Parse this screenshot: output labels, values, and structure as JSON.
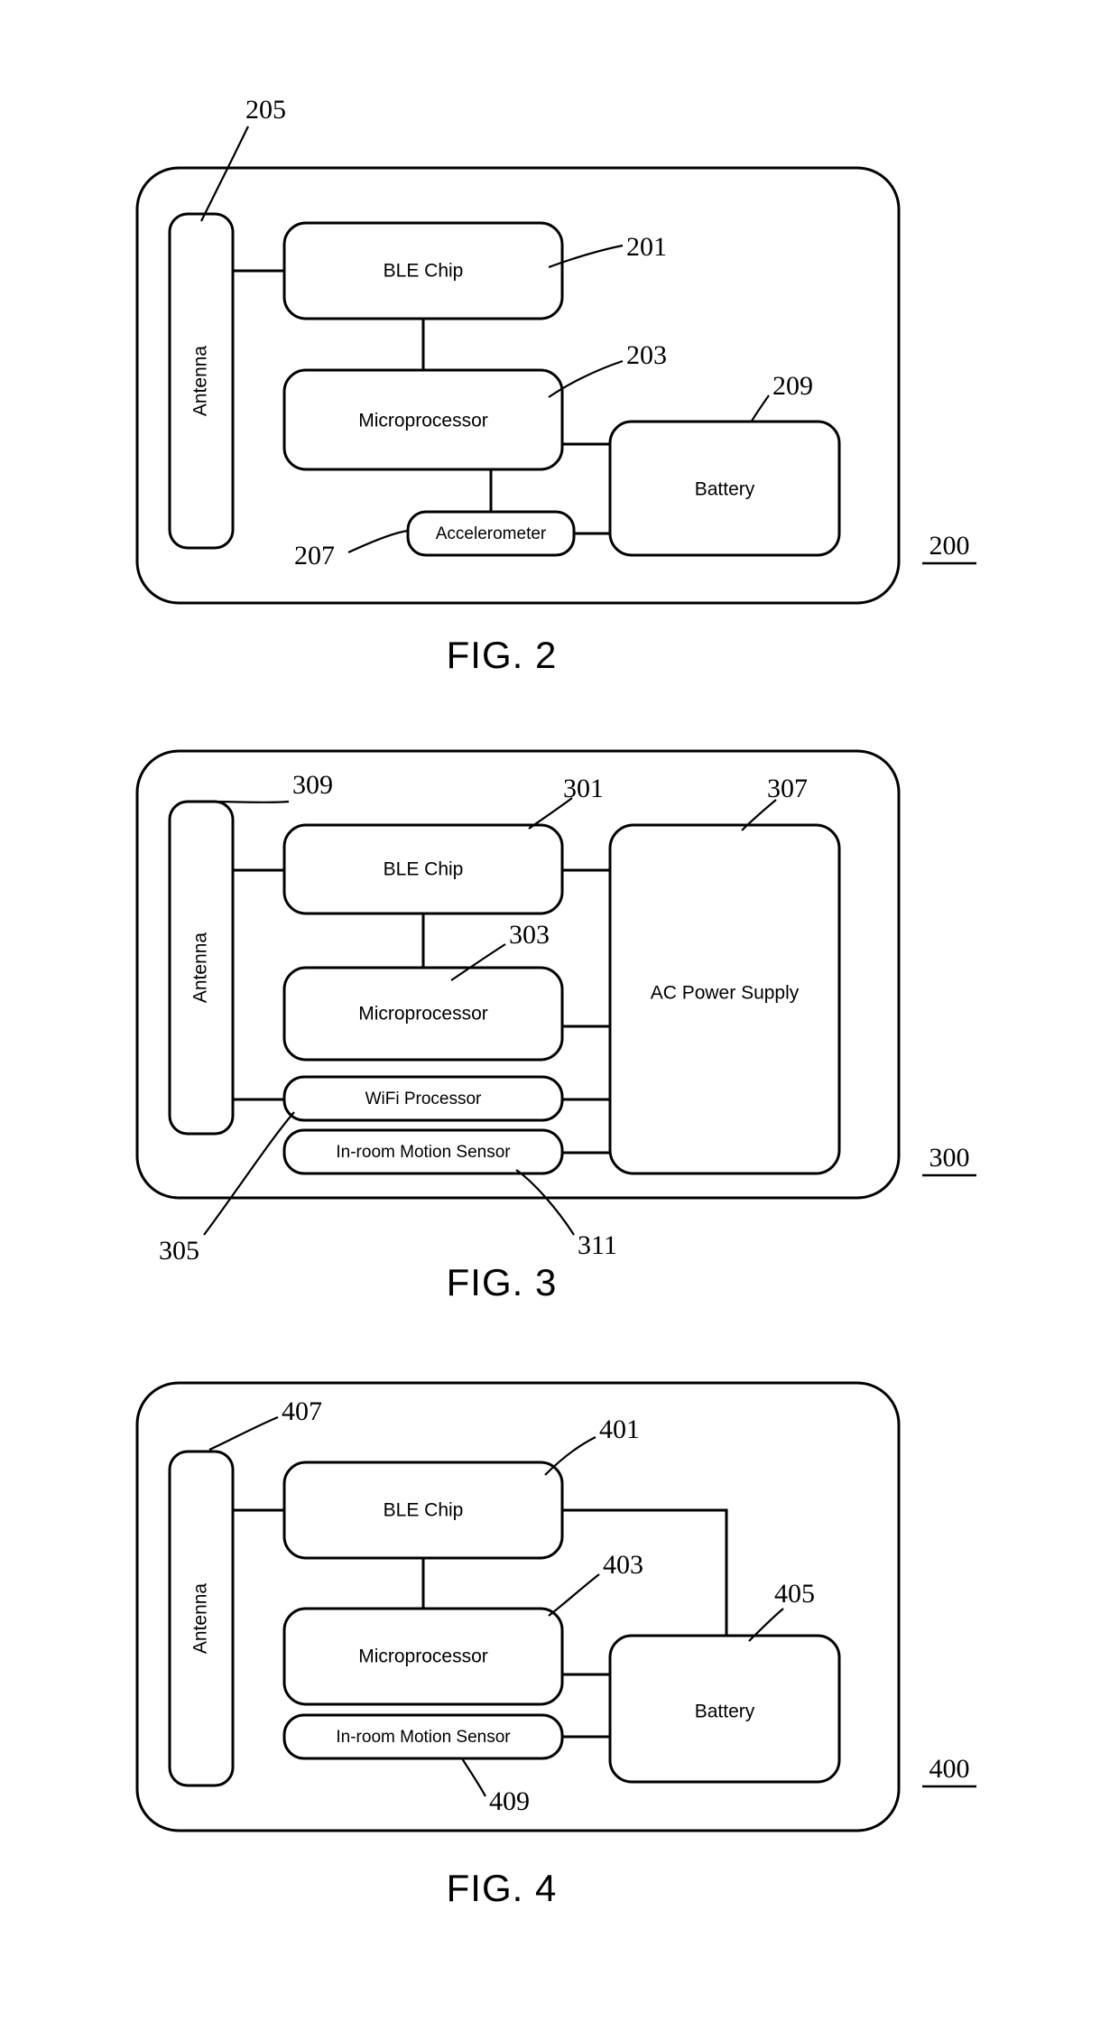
{
  "document": {
    "type": "patent-figure-sheet",
    "figures": [
      {
        "id": "fig2",
        "caption": "FIG. 2",
        "assembly_number": "200",
        "blocks": [
          {
            "key": "antenna",
            "label": "Antenna",
            "ref": "205"
          },
          {
            "key": "ble_chip",
            "label": "BLE Chip",
            "ref": "201"
          },
          {
            "key": "microprocessor",
            "label": "Microprocessor",
            "ref": "203"
          },
          {
            "key": "accelerometer",
            "label": "Accelerometer",
            "ref": "207"
          },
          {
            "key": "battery",
            "label": "Battery",
            "ref": "209"
          }
        ],
        "reference_numerals": [
          "205",
          "201",
          "203",
          "209",
          "207"
        ],
        "connections": [
          {
            "from": "antenna",
            "to": "ble_chip"
          },
          {
            "from": "ble_chip",
            "to": "microprocessor"
          },
          {
            "from": "microprocessor",
            "to": "accelerometer"
          },
          {
            "from": "microprocessor",
            "to": "battery"
          },
          {
            "from": "accelerometer",
            "to": "battery"
          }
        ]
      },
      {
        "id": "fig3",
        "caption": "FIG. 3",
        "assembly_number": "300",
        "blocks": [
          {
            "key": "antenna",
            "label": "Antenna",
            "ref": "309"
          },
          {
            "key": "ble_chip",
            "label": "BLE Chip",
            "ref": "301"
          },
          {
            "key": "microprocessor",
            "label": "Microprocessor",
            "ref": "303"
          },
          {
            "key": "wifi_processor",
            "label": "WiFi Processor",
            "ref": "305"
          },
          {
            "key": "motion_sensor",
            "label": "In-room Motion Sensor",
            "ref": "311"
          },
          {
            "key": "ac_power_supply",
            "label": "AC Power Supply",
            "ref": "307"
          }
        ],
        "reference_numerals": [
          "309",
          "301",
          "307",
          "303",
          "305",
          "311"
        ],
        "connections": [
          {
            "from": "antenna",
            "to": "ble_chip"
          },
          {
            "from": "antenna",
            "to": "wifi_processor"
          },
          {
            "from": "ble_chip",
            "to": "microprocessor"
          },
          {
            "from": "ble_chip",
            "to": "ac_power_supply"
          },
          {
            "from": "microprocessor",
            "to": "ac_power_supply"
          },
          {
            "from": "wifi_processor",
            "to": "ac_power_supply"
          },
          {
            "from": "motion_sensor",
            "to": "ac_power_supply"
          }
        ]
      },
      {
        "id": "fig4",
        "caption": "FIG. 4",
        "assembly_number": "400",
        "blocks": [
          {
            "key": "antenna",
            "label": "Antenna",
            "ref": "407"
          },
          {
            "key": "ble_chip",
            "label": "BLE Chip",
            "ref": "401"
          },
          {
            "key": "microprocessor",
            "label": "Microprocessor",
            "ref": "403"
          },
          {
            "key": "motion_sensor",
            "label": "In-room Motion Sensor",
            "ref": "409"
          },
          {
            "key": "battery",
            "label": "Battery",
            "ref": "405"
          }
        ],
        "reference_numerals": [
          "407",
          "401",
          "403",
          "405",
          "409"
        ],
        "connections": [
          {
            "from": "antenna",
            "to": "ble_chip"
          },
          {
            "from": "ble_chip",
            "to": "microprocessor"
          },
          {
            "from": "ble_chip",
            "to": "battery"
          },
          {
            "from": "microprocessor",
            "to": "battery"
          },
          {
            "from": "motion_sensor",
            "to": "battery"
          }
        ]
      }
    ]
  },
  "fig2": {
    "caption": "FIG. 2",
    "assembly": "200",
    "antenna": "Antenna",
    "ble_chip": "BLE Chip",
    "microprocessor": "Microprocessor",
    "accelerometer": "Accelerometer",
    "battery": "Battery",
    "ref_205": "205",
    "ref_201": "201",
    "ref_203": "203",
    "ref_209": "209",
    "ref_207": "207"
  },
  "fig3": {
    "caption": "FIG. 3",
    "assembly": "300",
    "antenna": "Antenna",
    "ble_chip": "BLE Chip",
    "microprocessor": "Microprocessor",
    "wifi_processor": "WiFi Processor",
    "motion_sensor": "In-room Motion Sensor",
    "ac_power_supply": "AC Power Supply",
    "ref_309": "309",
    "ref_301": "301",
    "ref_307": "307",
    "ref_303": "303",
    "ref_305": "305",
    "ref_311": "311"
  },
  "fig4": {
    "caption": "FIG. 4",
    "assembly": "400",
    "antenna": "Antenna",
    "ble_chip": "BLE Chip",
    "microprocessor": "Microprocessor",
    "motion_sensor": "In-room Motion Sensor",
    "battery": "Battery",
    "ref_407": "407",
    "ref_401": "401",
    "ref_403": "403",
    "ref_405": "405",
    "ref_409": "409"
  },
  "colors": {
    "ink": "#000000",
    "paper": "#ffffff"
  }
}
